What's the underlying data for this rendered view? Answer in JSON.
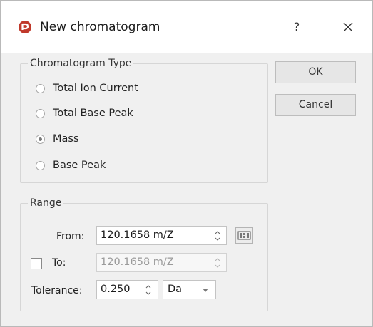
{
  "window": {
    "title": "New chromatogram",
    "help_label": "?"
  },
  "chromatogram_type": {
    "legend": "Chromatogram Type",
    "options": [
      {
        "label": "Total Ion Current",
        "selected": false
      },
      {
        "label": "Total Base Peak",
        "selected": false
      },
      {
        "label": "Mass",
        "selected": true
      },
      {
        "label": "Base Peak",
        "selected": false
      }
    ]
  },
  "buttons": {
    "ok_label": "OK",
    "cancel_label": "Cancel"
  },
  "range": {
    "legend": "Range",
    "from_label": "From:",
    "from_value": "120.1658 m/Z",
    "to_label": "To:",
    "to_checked": false,
    "to_value": "120.1658 m/Z",
    "to_enabled": false,
    "tolerance_label": "Tolerance:",
    "tolerance_value": "0.250",
    "unit_value": "Da"
  },
  "colors": {
    "app_icon": "#c0392b",
    "dialog_background": "#f0f0f0",
    "title_background": "#ffffff"
  },
  "icons": {
    "app": "chromatogram-app-icon",
    "close": "close-icon",
    "calculator": "calculator-icon"
  }
}
